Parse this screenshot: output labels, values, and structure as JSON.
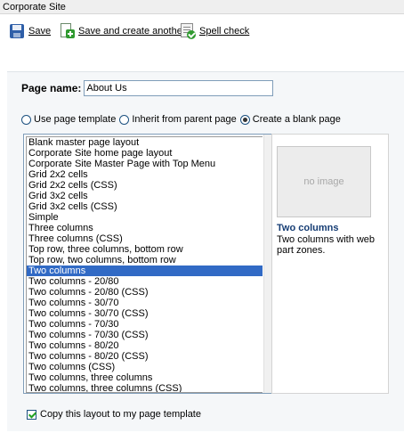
{
  "window": {
    "title": "Corporate Site"
  },
  "toolbar": {
    "save_label": "Save",
    "save_create_label": "Save and create another",
    "spell_check_label": "Spell check"
  },
  "form": {
    "page_name_label": "Page name:",
    "page_name_value": "About Us",
    "template_options": [
      {
        "label": "Use page template",
        "selected": false
      },
      {
        "label": "Inherit from parent page",
        "selected": false
      },
      {
        "label": "Create a blank page",
        "selected": true
      }
    ],
    "layouts": [
      "Blank master page layout",
      "Corporate Site home page layout",
      "Corporate Site Master Page with Top Menu",
      "Grid 2x2 cells",
      "Grid 2x2 cells (CSS)",
      "Grid 3x2 cells",
      "Grid 3x2 cells (CSS)",
      "Simple",
      "Three columns",
      "Three columns (CSS)",
      "Top row, three columns, bottom row",
      "Top row, two columns, bottom row",
      "Two columns",
      "Two columns - 20/80",
      "Two columns - 20/80 (CSS)",
      "Two columns - 30/70",
      "Two columns - 30/70 (CSS)",
      "Two columns - 70/30",
      "Two columns - 70/30 (CSS)",
      "Two columns - 80/20",
      "Two columns - 80/20 (CSS)",
      "Two columns (CSS)",
      "Two columns, three columns",
      "Two columns, three columns (CSS)"
    ],
    "selected_layout": "Two columns",
    "preview": {
      "placeholder": "no image",
      "title": "Two columns",
      "description": "Two columns with web part zones."
    },
    "copy_layout_label": "Copy this layout to my page template",
    "copy_layout_checked": true
  }
}
